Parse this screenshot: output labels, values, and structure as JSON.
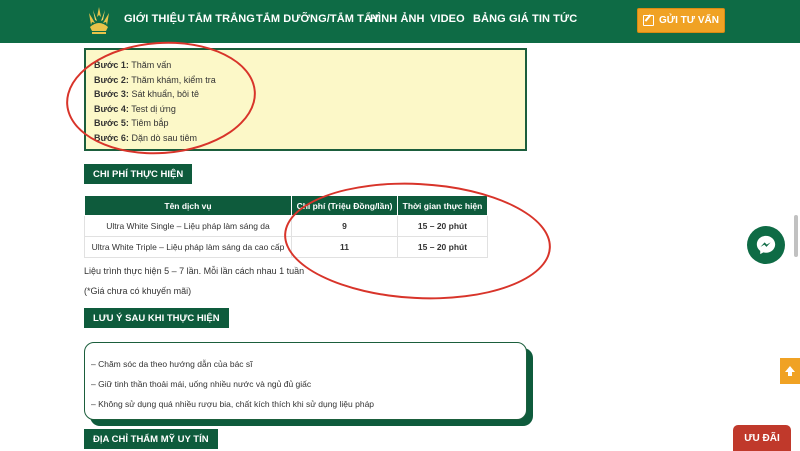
{
  "nav": {
    "items": [
      "GIỚI THIỆU",
      "TẮM TRẮNG",
      "TẮM DƯỠNG/TẮM TẨY",
      "HÌNH ẢNH",
      "VIDEO",
      "BẢNG GIÁ",
      "TIN TỨC"
    ],
    "cta_label": "GỬI TƯ VẤN"
  },
  "steps": [
    {
      "label": "Bước 1:",
      "text": " Thăm vấn"
    },
    {
      "label": "Bước 2:",
      "text": " Thăm khám, kiểm tra"
    },
    {
      "label": "Bước 3:",
      "text": " Sát khuẩn, bôi tê"
    },
    {
      "label": "Bước 4:",
      "text": " Test dị ứng"
    },
    {
      "label": "Bước 5:",
      "text": " Tiêm bắp"
    },
    {
      "label": "Bước 6:",
      "text": " Dặn dò sau tiêm"
    }
  ],
  "cost_section": {
    "heading": "CHI PHÍ THỰC HIỆN",
    "table": {
      "headers": [
        "Tên dịch vụ",
        "Chi phí (Triệu Đồng/lần)",
        "Thời gian thực hiện"
      ],
      "rows": [
        [
          "Ultra White Single – Liệu pháp làm sáng da",
          "9",
          "15 – 20 phút"
        ],
        [
          "Ultra White Triple – Liệu pháp làm sáng da cao cấp",
          "11",
          "15 – 20 phút"
        ]
      ]
    },
    "note1": "Liệu trình thực hiện 5 – 7 lần. Mỗi lần cách nhau 1 tuần",
    "note2": "(*Giá chưa có khuyến mãi)"
  },
  "aftercare_section": {
    "heading": "LƯU Ý SAU KHI THỰC HIỆN",
    "items": [
      "– Chăm sóc da theo hướng dẫn của bác sĩ",
      "– Giữ tinh thần thoải mái, uống nhiều nước và ngủ đủ giấc",
      "– Không sử dụng quá nhiều rượu bia, chất kích thích khi sử dụng liệu pháp"
    ]
  },
  "address_heading": "ĐỊA CHỈ THẨM MỸ UY TÍN",
  "floating": {
    "promo_label": "ƯU ĐÃI",
    "messenger_icon": "messenger-icon",
    "up_icon": "arrow-up-icon"
  },
  "colors": {
    "brand_green": "#0e6b45",
    "accent_orange": "#f0a224",
    "highlight_red": "#d8342a",
    "steps_bg": "#fcf8c8"
  }
}
